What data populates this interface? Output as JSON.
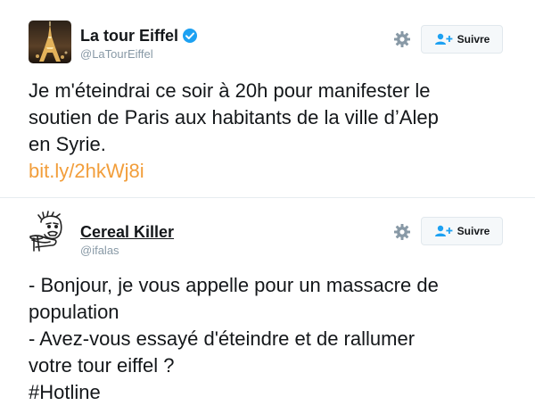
{
  "tweets": [
    {
      "display_name": "La tour Eiffel",
      "handle": "@LaTourEiffel",
      "verified": true,
      "follow_label": "Suivre",
      "text_lines": [
        "Je m'éteindrai ce soir à 20h pour manifester le",
        "soutien de Paris aux habitants de la ville d’Alep",
        "en Syrie."
      ],
      "link": "bit.ly/2hkWj8i"
    },
    {
      "display_name": "Cereal Killer",
      "handle": "@ifalas",
      "verified": false,
      "follow_label": "Suivre",
      "text_lines": [
        "- Bonjour, je vous appelle pour un massacre de",
        "population",
        "- Avez-vous essayé d'éteindre et de rallumer",
        "votre tour eiffel ?",
        "#Hotline"
      ]
    }
  ],
  "colors": {
    "link": "#f29e3b",
    "verified": "#1da1f2",
    "follow_icon": "#1da1f2",
    "gear": "#8899a6"
  },
  "icons": [
    "eiffel-tower-avatar",
    "cereal-guy-avatar",
    "verified-icon",
    "gear-icon",
    "follow-user-icon"
  ]
}
